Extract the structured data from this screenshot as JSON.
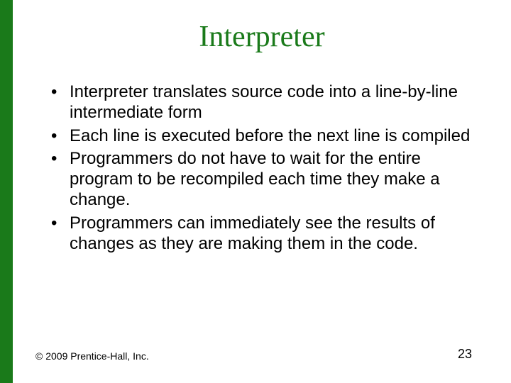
{
  "title": "Interpreter",
  "bullets": [
    "Interpreter translates source code into a line-by-line intermediate form",
    "Each line is executed before the next line is compiled",
    "Programmers do not have to wait for the entire program to be recompiled each time they make a change.",
    "Programmers can immediately see the results of changes as they are making them in the code."
  ],
  "footer": "© 2009 Prentice-Hall, Inc.",
  "page_number": "23"
}
